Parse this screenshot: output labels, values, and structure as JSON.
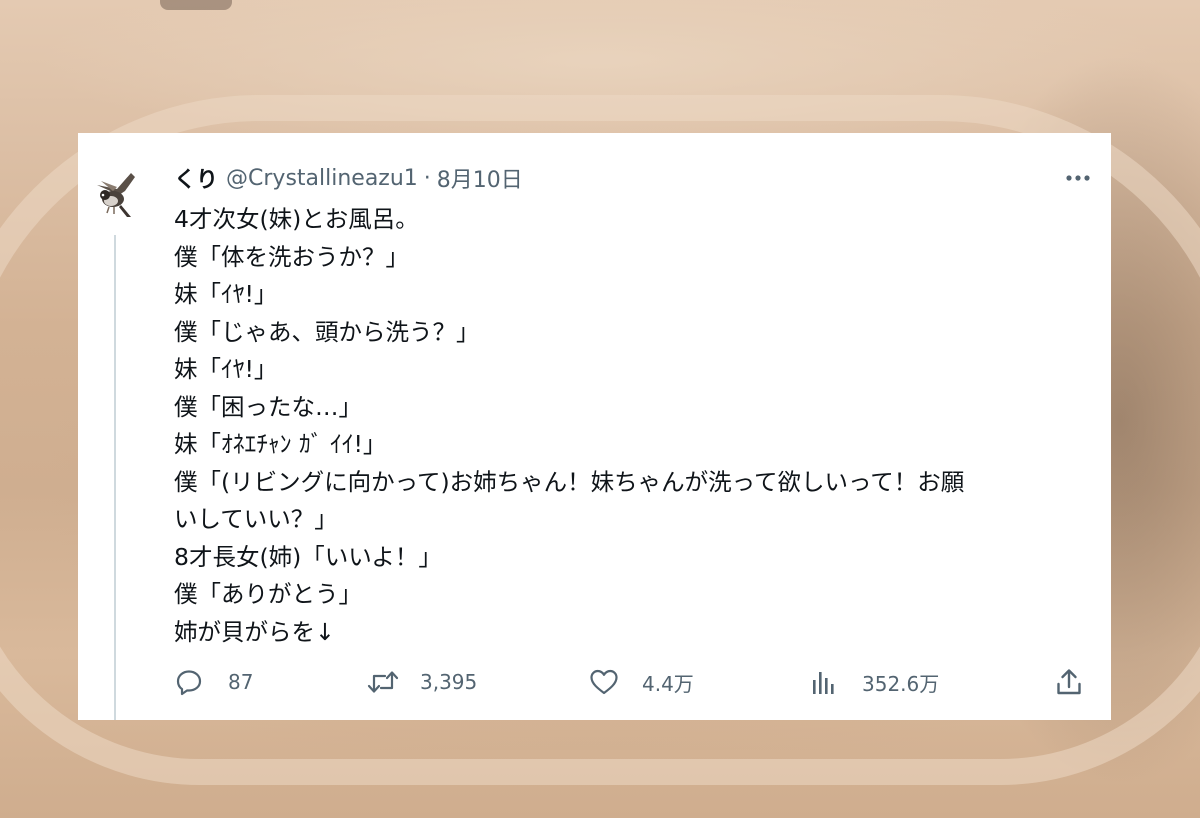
{
  "tweet": {
    "display_name": "くり",
    "handle": "@Crystallineazu1",
    "separator": "·",
    "date": "8月10日",
    "lines": [
      "4才次女(妹)とお風呂。",
      "僕「体を洗おうか？」",
      "妹「ｲﾔ!」",
      "僕「じゃあ、頭から洗う？」",
      "妹「ｲﾔ!」",
      "僕「困ったな…」",
      "妹「ｵﾈｴﾁｬﾝ ｶﾞ ｲｲ!」",
      "僕「(リビングに向かって)お姉ちゃん！妹ちゃんが洗って欲しいって！お願",
      "いしていい？」",
      "8才長女(姉)「いいよ！」",
      "僕「ありがとう」",
      "姉が貝がらを↓"
    ],
    "stats": {
      "replies": "87",
      "retweets": "3,395",
      "likes": "4.4万",
      "views": "352.6万"
    }
  },
  "icons": {
    "avatar": "bird-photo-avatar",
    "more": "more-horizontal-icon",
    "reply": "reply-icon",
    "retweet": "retweet-icon",
    "like": "heart-icon",
    "views": "analytics-icon",
    "share": "share-icon"
  },
  "colors": {
    "text": "#0f1419",
    "secondary": "#536471",
    "thread_line": "#cfd9de",
    "card_background": "#ffffff"
  }
}
